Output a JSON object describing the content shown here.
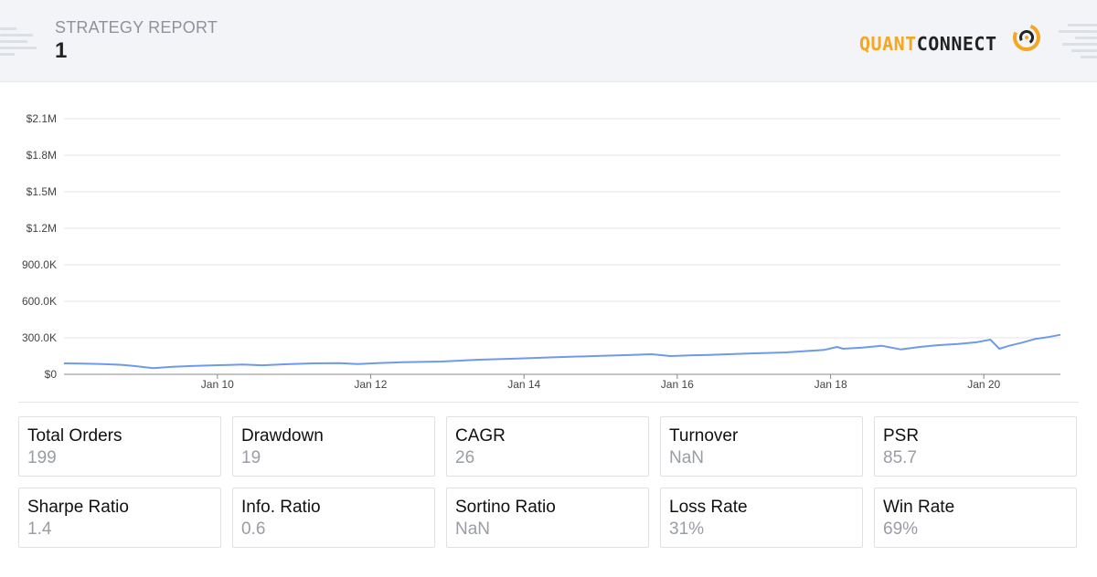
{
  "header": {
    "subtitle": "STRATEGY REPORT",
    "title": "1",
    "logo": {
      "part1": "QUANT",
      "part2": "CONNECT",
      "accent": "#f5a623",
      "icon": "quantconnect-logo-icon"
    }
  },
  "chart_data": {
    "type": "line",
    "title": "",
    "xlabel": "",
    "ylabel": "",
    "ylim": [
      0,
      2100000
    ],
    "xlim": [
      "2008-01-01",
      "2020-12-31"
    ],
    "yticks": [
      {
        "v": 0,
        "label": "$0"
      },
      {
        "v": 300000,
        "label": "300.0K"
      },
      {
        "v": 600000,
        "label": "600.0K"
      },
      {
        "v": 900000,
        "label": "900.0K"
      },
      {
        "v": 1200000,
        "label": "$1.2M"
      },
      {
        "v": 1500000,
        "label": "$1.5M"
      },
      {
        "v": 1800000,
        "label": "$1.8M"
      },
      {
        "v": 2100000,
        "label": "$2.1M"
      }
    ],
    "xticks": [
      {
        "date": "2010-01-01",
        "label": "Jan 10"
      },
      {
        "date": "2012-01-01",
        "label": "Jan 12"
      },
      {
        "date": "2014-01-01",
        "label": "Jan 14"
      },
      {
        "date": "2016-01-01",
        "label": "Jan 16"
      },
      {
        "date": "2018-01-01",
        "label": "Jan 18"
      },
      {
        "date": "2020-01-01",
        "label": "Jan 20"
      }
    ],
    "grid": true,
    "series": [
      {
        "color": "#6d9bea",
        "points": [
          [
            "2008-01-01",
            90000
          ],
          [
            "2008-04-01",
            88000
          ],
          [
            "2008-07-01",
            85000
          ],
          [
            "2008-10-01",
            78000
          ],
          [
            "2008-12-01",
            68000
          ],
          [
            "2009-03-01",
            50000
          ],
          [
            "2009-06-01",
            62000
          ],
          [
            "2009-09-01",
            68000
          ],
          [
            "2010-01-01",
            75000
          ],
          [
            "2010-05-01",
            80000
          ],
          [
            "2010-08-01",
            74000
          ],
          [
            "2010-12-01",
            83000
          ],
          [
            "2011-04-01",
            90000
          ],
          [
            "2011-08-01",
            92000
          ],
          [
            "2011-11-01",
            85000
          ],
          [
            "2012-02-01",
            92000
          ],
          [
            "2012-06-01",
            100000
          ],
          [
            "2012-12-01",
            105000
          ],
          [
            "2013-06-01",
            120000
          ],
          [
            "2013-12-01",
            130000
          ],
          [
            "2014-06-01",
            140000
          ],
          [
            "2014-12-01",
            150000
          ],
          [
            "2015-06-01",
            160000
          ],
          [
            "2015-09-01",
            165000
          ],
          [
            "2015-12-01",
            150000
          ],
          [
            "2016-03-01",
            155000
          ],
          [
            "2016-06-01",
            160000
          ],
          [
            "2016-12-01",
            170000
          ],
          [
            "2017-06-01",
            180000
          ],
          [
            "2017-12-01",
            200000
          ],
          [
            "2018-02-01",
            225000
          ],
          [
            "2018-03-01",
            210000
          ],
          [
            "2018-06-01",
            220000
          ],
          [
            "2018-09-01",
            235000
          ],
          [
            "2018-12-01",
            205000
          ],
          [
            "2019-03-01",
            225000
          ],
          [
            "2019-06-01",
            240000
          ],
          [
            "2019-09-01",
            250000
          ],
          [
            "2019-12-01",
            265000
          ],
          [
            "2020-02-01",
            285000
          ],
          [
            "2020-03-15",
            210000
          ],
          [
            "2020-05-01",
            235000
          ],
          [
            "2020-07-01",
            260000
          ],
          [
            "2020-09-01",
            290000
          ],
          [
            "2020-11-01",
            305000
          ],
          [
            "2020-12-31",
            325000
          ]
        ]
      }
    ]
  },
  "stats": [
    {
      "label": "Total Orders",
      "value": "199"
    },
    {
      "label": "Drawdown",
      "value": "19"
    },
    {
      "label": "CAGR",
      "value": "26"
    },
    {
      "label": "Turnover",
      "value": "NaN"
    },
    {
      "label": "PSR",
      "value": "85.7"
    },
    {
      "label": "Sharpe Ratio",
      "value": "1.4"
    },
    {
      "label": "Info. Ratio",
      "value": "0.6"
    },
    {
      "label": "Sortino Ratio",
      "value": "NaN"
    },
    {
      "label": "Loss Rate",
      "value": "31%"
    },
    {
      "label": "Win Rate",
      "value": "69%"
    }
  ]
}
